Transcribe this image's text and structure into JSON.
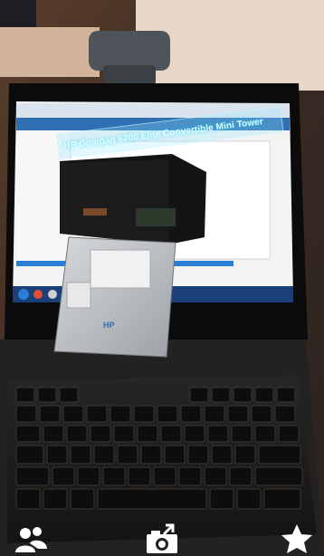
{
  "ar_overlay": {
    "product_title": "HP Compaq 6200 Elite Convertible Mini Tower",
    "ar_badge": "HP"
  },
  "toolbar": {
    "share_icon": "people-icon",
    "capture_icon": "camera-share-icon",
    "favorite_icon": "star-icon"
  },
  "colors": {
    "overlay_glow": "#8fe6ff",
    "toolbar_icon": "#ffffff"
  }
}
